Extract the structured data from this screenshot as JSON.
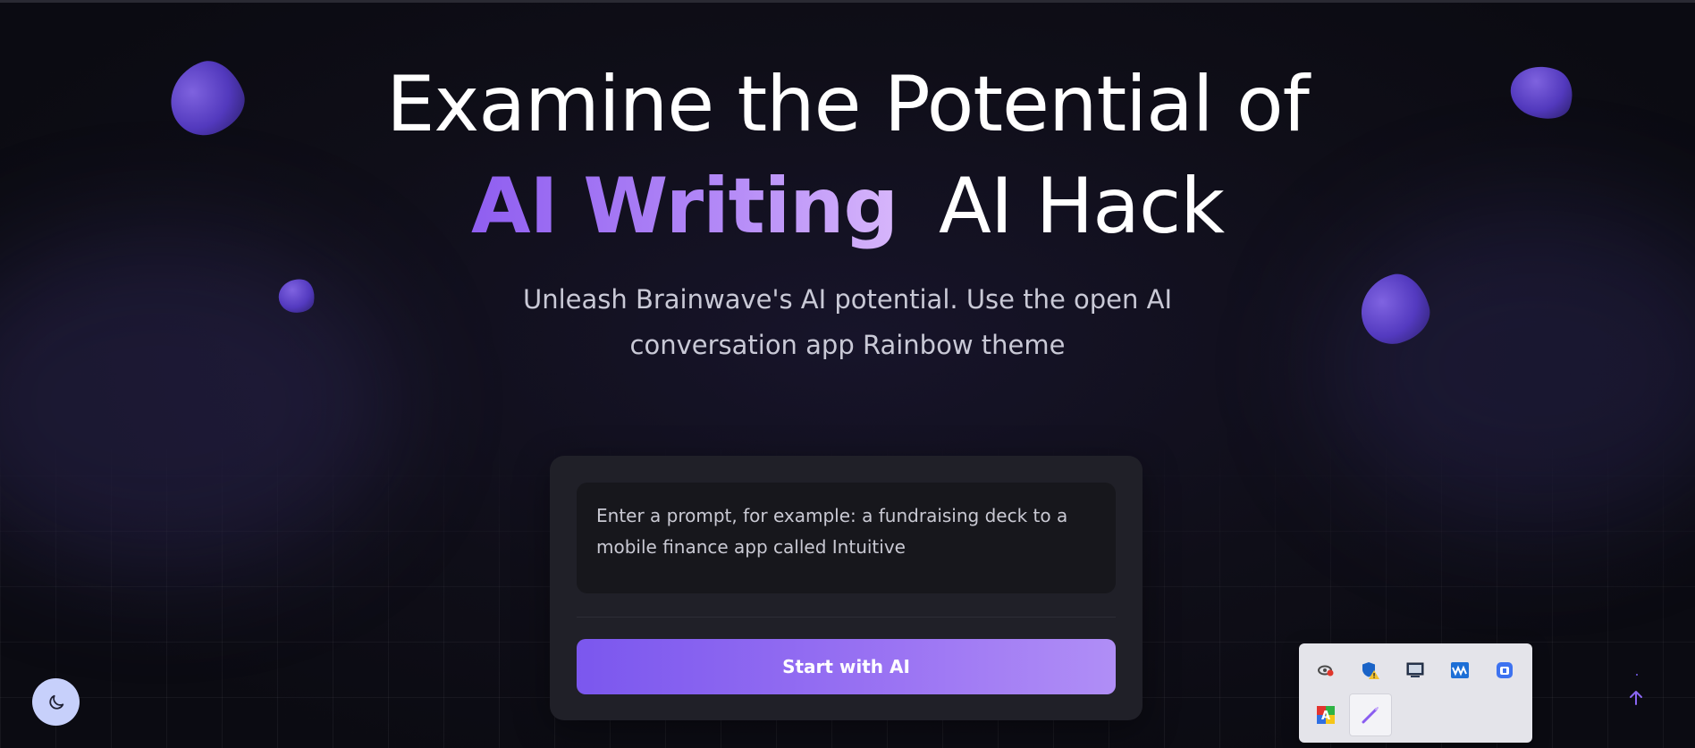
{
  "hero": {
    "line1": "Examine the Potential of",
    "accent": "AI Writing",
    "line2_rest": "AI Hack",
    "subtitle_line1": "Unleash Brainwave's AI potential. Use the open AI",
    "subtitle_line2": "conversation app Rainbow theme"
  },
  "prompt_card": {
    "placeholder": "Enter a prompt, for example: a fundraising deck to a mobile finance app called Intuitive",
    "start_label": "Start with AI"
  },
  "theme_toggle": {
    "icon": "moon-icon"
  },
  "scroll_top": {
    "icon": "arrow-up-icon"
  },
  "system_tray": {
    "icons": [
      "nvidia-icon",
      "security-shield-warning-icon",
      "display-icon",
      "audio-equalizer-icon",
      "cloud-sync-icon",
      "language-input-icon",
      "pen-icon"
    ]
  },
  "colors": {
    "accent_start": "#8f5ef0",
    "accent_end": "#d7b6fb",
    "button_start": "#7b57ee",
    "button_end": "#b08ef6",
    "background": "#0f0e18",
    "card": "#202028",
    "toggle_bg": "#c7d0fb"
  }
}
